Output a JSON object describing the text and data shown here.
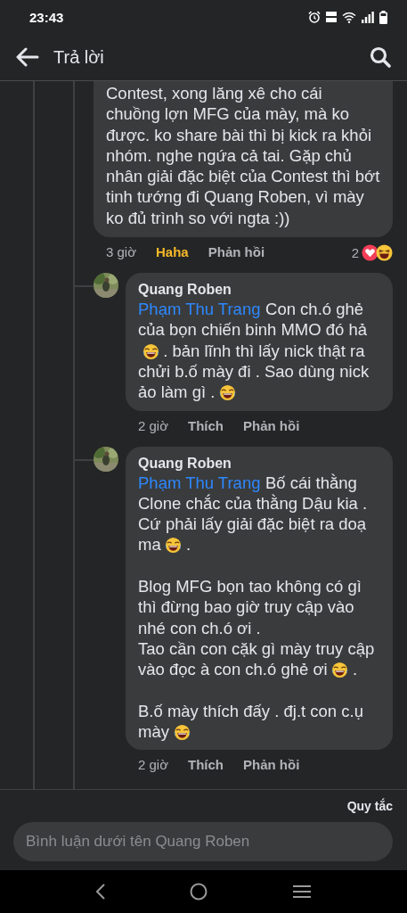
{
  "status_bar": {
    "time": "23:43"
  },
  "header": {
    "title": "Trả lời"
  },
  "comment": {
    "body": [
      [
        {
          "kind": "text",
          "text": "Contest, xong lăng xê cho cái chuồng lợn MFG của mày, mà ko được. ko share bài thì bị kick ra khỏi nhóm. nghe ngứa cả tai. Gặp chủ nhân giải đặc biệt của Contest thì bớt tinh tướng đi Quang Roben, vì mày ko đủ trình so với ngta :))"
        }
      ]
    ],
    "actions": {
      "time": "3 giờ",
      "reaction": {
        "label": "Haha",
        "reacted": true
      },
      "reply": "Phản hồi"
    },
    "reactions": {
      "count": "2"
    },
    "replies": [
      {
        "author": "Quang Roben",
        "body": [
          [
            {
              "kind": "mention",
              "text": "Phạm Thu Trang"
            },
            {
              "kind": "text",
              "text": "Con ch.ó ghẻ của bọn chiến binh MMO đó hả"
            },
            {
              "kind": "emoji"
            },
            {
              "kind": "text",
              "text": ". bản lĩnh thì lấy nick thật ra chửi b.ố mày đi . Sao dùng nick ảo làm gì ."
            },
            {
              "kind": "emoji"
            }
          ]
        ],
        "actions": {
          "time": "2 giờ",
          "reaction": {
            "label": "Thích",
            "reacted": false
          },
          "reply": "Phản hồi"
        }
      },
      {
        "author": "Quang Roben",
        "body": [
          [
            {
              "kind": "mention",
              "text": "Phạm Thu Trang"
            },
            {
              "kind": "text",
              "text": "Bố cái thằng Clone chắc của thằng Dậu kia . Cứ phải lấy giải đặc biệt ra doạ ma"
            },
            {
              "kind": "emoji"
            },
            {
              "kind": "text",
              "text": "."
            }
          ],
          [
            {
              "kind": "text",
              "text": "Blog MFG bọn tao không có gì thì đừng bao giờ truy cập vào nhé con ch.ó ơi ."
            },
            {
              "kind": "break"
            },
            {
              "kind": "text",
              "text": "Tao cần con cặk gì mày truy cập vào đọc à con ch.ó ghẻ ơi"
            },
            {
              "kind": "emoji"
            },
            {
              "kind": "text",
              "text": "."
            }
          ],
          [
            {
              "kind": "text",
              "text": "B.ố mày thích đấy . đj.t con c.ụ mày"
            },
            {
              "kind": "emoji"
            }
          ]
        ],
        "actions": {
          "time": "2 giờ",
          "reaction": {
            "label": "Thích",
            "reacted": false
          },
          "reply": "Phản hồi"
        }
      }
    ]
  },
  "composer": {
    "rules_link": "Quy tắc",
    "placeholder": "Bình luận dưới tên Quang Roben"
  }
}
